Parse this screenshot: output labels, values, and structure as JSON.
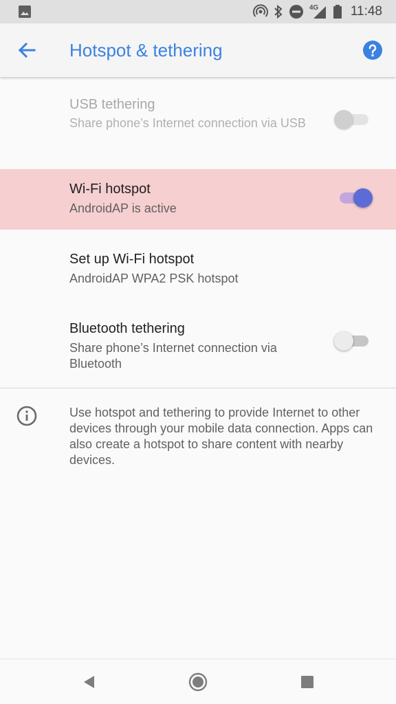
{
  "status_bar": {
    "time": "11:48",
    "network": "4G",
    "icons": [
      "image-icon",
      "hotspot-icon",
      "bluetooth-icon",
      "do-not-disturb-icon",
      "signal-icon",
      "battery-icon"
    ]
  },
  "app_bar": {
    "title": "Hotspot & tethering",
    "back_icon": "arrow-back-icon",
    "help_icon": "help-icon"
  },
  "settings": {
    "usb": {
      "title": "USB tethering",
      "summary": "Share phone’s Internet connection via USB",
      "enabled": false,
      "checked": false
    },
    "wifi_hotspot": {
      "title": "Wi-Fi hotspot",
      "summary": "AndroidAP is active",
      "enabled": true,
      "checked": true
    },
    "setup_hotspot": {
      "title": "Set up Wi-Fi hotspot",
      "summary": "AndroidAP WPA2 PSK hotspot"
    },
    "bluetooth": {
      "title": "Bluetooth tethering",
      "summary": "Share phone’s Internet connection via Bluetooth",
      "enabled": true,
      "checked": false
    }
  },
  "info": {
    "icon": "info-icon",
    "text": "Use hotspot and tethering to provide Internet to other devices through your mobile data connection. Apps can also create a hotspot to share content with nearby devices."
  },
  "colors": {
    "accent": "#3b82e0",
    "highlight_row": "#f6cfd0",
    "switch_on": "#5c6bd6"
  },
  "nav_bar": {
    "icons": [
      "nav-back-icon",
      "nav-home-icon",
      "nav-recents-icon"
    ]
  }
}
